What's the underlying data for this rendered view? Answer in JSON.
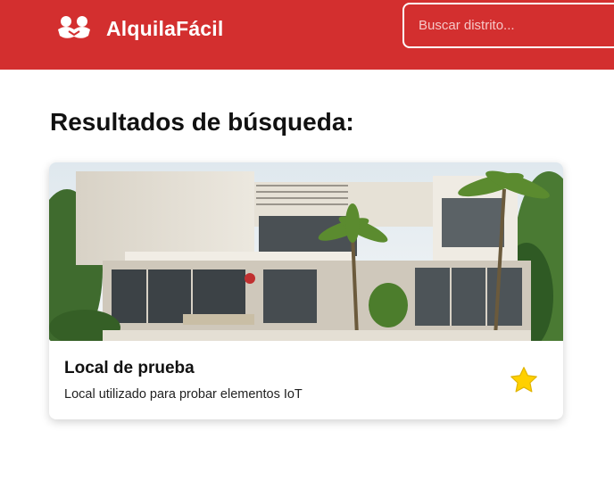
{
  "header": {
    "brand_name": "AlquilaFácil",
    "logo_icon": "people-handshake-icon",
    "search_placeholder": "Buscar distrito...",
    "color": "#d32f2f"
  },
  "main": {
    "title": "Resultados de búsqueda:",
    "results": [
      {
        "title": "Local de prueba",
        "description": "Local utilizado para probar elementos IoT",
        "image_icon": "modern-house-photo",
        "favorite_icon": "star-icon",
        "favorite_color": "#ffd000"
      }
    ]
  }
}
